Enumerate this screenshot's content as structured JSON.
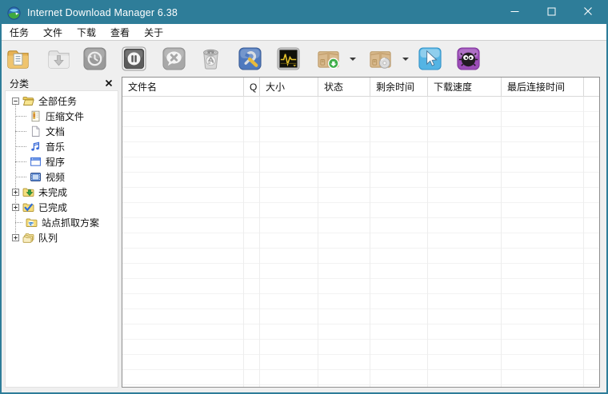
{
  "window": {
    "title": "Internet Download Manager 6.38",
    "accent_color": "#2E7D99",
    "controls": [
      {
        "name": "minimize",
        "icon": "minimize-icon"
      },
      {
        "name": "maximize",
        "icon": "maximize-icon"
      },
      {
        "name": "close",
        "icon": "close-icon"
      }
    ]
  },
  "menubar": {
    "items": [
      "任务",
      "文件",
      "下载",
      "查看",
      "关于"
    ]
  },
  "toolbar": {
    "buttons": [
      {
        "name": "add-url",
        "icon": "add-url-icon",
        "enabled": true,
        "dropdown": false
      },
      {
        "name": "download-now",
        "icon": "download-icon",
        "enabled": false,
        "dropdown": false
      },
      {
        "name": "redownload",
        "icon": "redownload-icon",
        "enabled": false,
        "dropdown": false
      },
      {
        "name": "stop",
        "icon": "stop-icon",
        "enabled": true,
        "dropdown": false
      },
      {
        "name": "stop-all",
        "icon": "stop-all-icon",
        "enabled": true,
        "dropdown": false
      },
      {
        "name": "delete",
        "icon": "delete-icon",
        "enabled": true,
        "dropdown": false
      },
      {
        "name": "options",
        "icon": "options-icon",
        "enabled": true,
        "dropdown": false
      },
      {
        "name": "scheduler",
        "icon": "scheduler-icon",
        "enabled": true,
        "dropdown": false
      },
      {
        "name": "start-queue",
        "icon": "start-queue-icon",
        "enabled": true,
        "dropdown": true
      },
      {
        "name": "stop-queue",
        "icon": "stop-queue-icon",
        "enabled": true,
        "dropdown": true
      },
      {
        "name": "grabber",
        "icon": "grabber-icon",
        "enabled": true,
        "dropdown": false
      },
      {
        "name": "tonec-mascot",
        "icon": "tonec-mascot-icon",
        "enabled": true,
        "dropdown": false
      }
    ]
  },
  "sidebar": {
    "header": "分类",
    "close_icon": "close-panel-icon",
    "tree": [
      {
        "label": "全部任务",
        "level": 0,
        "expander": "minus",
        "icon": "all-tasks-folder-icon"
      },
      {
        "label": "压缩文件",
        "level": 1,
        "expander": "none",
        "icon": "compressed-file-icon"
      },
      {
        "label": "文档",
        "level": 1,
        "expander": "none",
        "icon": "document-file-icon"
      },
      {
        "label": "音乐",
        "level": 1,
        "expander": "none",
        "icon": "music-file-icon"
      },
      {
        "label": "程序",
        "level": 1,
        "expander": "none",
        "icon": "program-file-icon"
      },
      {
        "label": "视频",
        "level": 1,
        "expander": "none",
        "icon": "video-file-icon"
      },
      {
        "label": "未完成",
        "level": 0,
        "expander": "plus",
        "icon": "unfinished-folder-icon"
      },
      {
        "label": "已完成",
        "level": 0,
        "expander": "plus",
        "icon": "finished-folder-icon"
      },
      {
        "label": "站点抓取方案",
        "level": 0,
        "expander": "none",
        "icon": "site-grabber-icon"
      },
      {
        "label": "队列",
        "level": 0,
        "expander": "plus",
        "icon": "queues-folder-icon"
      }
    ]
  },
  "table": {
    "columns": [
      "文件名",
      "Q",
      "大小",
      "状态",
      "剩余时间",
      "下载速度",
      "最后连接时间",
      ""
    ]
  }
}
